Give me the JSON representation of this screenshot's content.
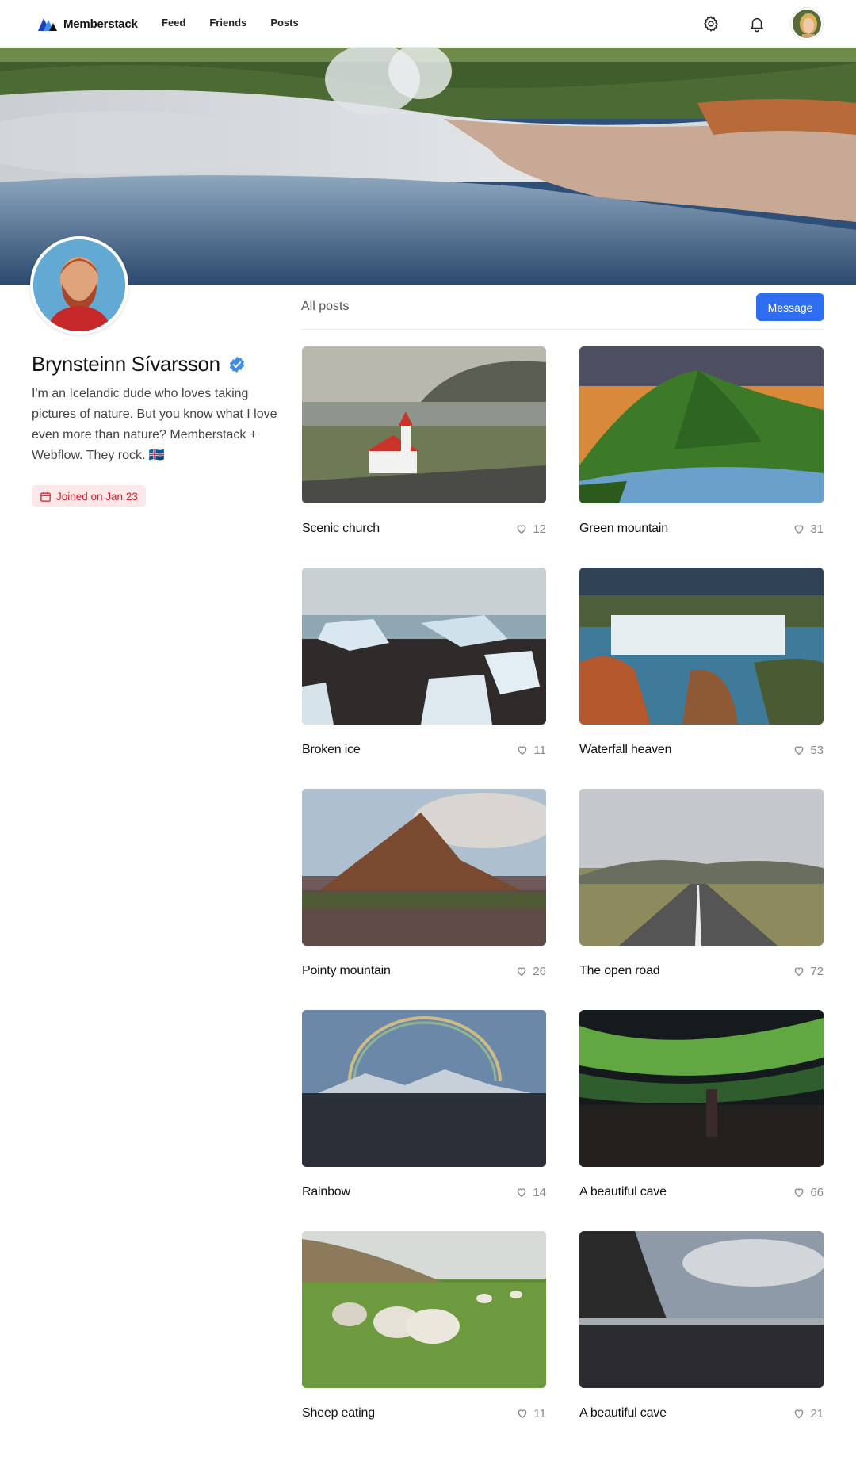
{
  "nav": {
    "brand": "Memberstack",
    "links": [
      "Feed",
      "Friends",
      "Posts"
    ],
    "settings_icon": "gear-icon",
    "notifications_icon": "bell-icon"
  },
  "profile": {
    "name": "Brynsteinn Sívarsson",
    "verified": true,
    "bio": "I'm an Icelandic dude who loves taking pictures of nature. But you know what I love even more than nature? Memberstack + Webflow. They rock. 🇮🇸",
    "joined": "Joined on Jan 23"
  },
  "posts_header": {
    "tab_label": "All posts",
    "message_button": "Message"
  },
  "posts": [
    {
      "title": "Scenic church",
      "likes": "12"
    },
    {
      "title": "Green mountain",
      "likes": "31"
    },
    {
      "title": "Broken ice",
      "likes": "11"
    },
    {
      "title": "Waterfall heaven",
      "likes": "53"
    },
    {
      "title": "Pointy mountain",
      "likes": "26"
    },
    {
      "title": "The open road",
      "likes": "72"
    },
    {
      "title": "Rainbow",
      "likes": "14"
    },
    {
      "title": "A beautiful cave",
      "likes": "66"
    },
    {
      "title": "Sheep eating",
      "likes": "11"
    },
    {
      "title": "A beautiful cave",
      "likes": "21"
    }
  ],
  "colors": {
    "accent": "#2e6ef0",
    "verified": "#3b8fe8",
    "joined_text": "#d11d2d",
    "joined_bg": "#fde8e9"
  }
}
